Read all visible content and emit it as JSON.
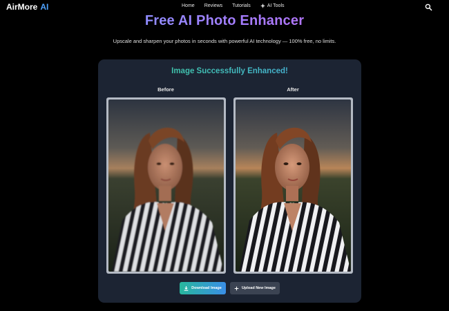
{
  "brand": {
    "name": "AirMore",
    "suffix": "AI",
    "accent": "#4fa3ff"
  },
  "nav": {
    "links": [
      {
        "label": "Home"
      },
      {
        "label": "Reviews"
      },
      {
        "label": "Tutorials"
      },
      {
        "label": "AI Tools",
        "icon": "sparkle-icon"
      }
    ],
    "search_icon": "search-icon"
  },
  "hero": {
    "title": "Free AI Photo Enhancer",
    "subtitle": "Upscale and sharpen your photos in seconds with powerful AI technology — 100% free, no limits."
  },
  "result": {
    "status": "Image Successfully Enhanced!",
    "before_label": "Before",
    "after_label": "After",
    "download_label": "Download Image",
    "upload_label": "Upload New Image"
  },
  "colors": {
    "background": "#000000",
    "card": "#1c2433",
    "title_gradient": [
      "#6ea4ff",
      "#c865e8"
    ],
    "status_gradient": [
      "#3ccf94",
      "#4aa9e8"
    ],
    "download_gradient": [
      "#28b79d",
      "#3a8ee6"
    ],
    "upload_button": "#3b4352"
  }
}
